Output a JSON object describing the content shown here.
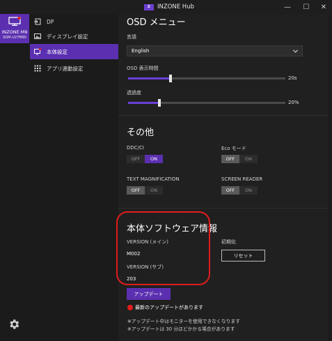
{
  "window": {
    "title": "INZONE Hub",
    "logo_text": "Z",
    "min_glyph": "—",
    "max_glyph": "☐",
    "close_glyph": "✕"
  },
  "monitor": {
    "name": "INZONE M9",
    "model": "SDM-U27M90"
  },
  "sidebar": {
    "items": [
      {
        "label": "DP",
        "icon": "input-source-icon"
      },
      {
        "label": "ディスプレイ設定",
        "icon": "image-icon"
      },
      {
        "label": "本体設定",
        "icon": "monitor-settings-icon",
        "active": true
      },
      {
        "label": "アプリ連動設定",
        "icon": "grid-icon"
      }
    ],
    "settings_icon": "gear-icon"
  },
  "osd": {
    "title": "OSD メニュー",
    "language_label": "言語",
    "language_value": "English",
    "display_time_label": "OSD 表示時間",
    "display_time_value": "20s",
    "display_time_fraction": 0.27,
    "opacity_label": "透過度",
    "opacity_value": "20%",
    "opacity_fraction": 0.2
  },
  "other": {
    "title": "その他",
    "ddcci": {
      "label": "DDC/CI",
      "off": "OFF",
      "on": "ON",
      "state": "on"
    },
    "eco": {
      "label": "Eco モード",
      "off": "OFF",
      "on": "ON",
      "state": "off"
    },
    "text_mag": {
      "label": "TEXT MAGNIFICATION",
      "off": "OFF",
      "on": "ON",
      "state": "off"
    },
    "screen_reader": {
      "label": "SCREEN READER",
      "off": "OFF",
      "on": "ON",
      "state": "off"
    }
  },
  "software": {
    "title": "本体ソフトウェア情報",
    "version_main_label": "VERSION (メイン)",
    "version_main": "M002",
    "version_sub_label": "VERSION (サブ)",
    "version_sub": "203",
    "init_label": "初期化",
    "reset_label": "リセット",
    "update_label": "アップデート",
    "update_alert": "最新のアップデートがあります",
    "note1": "※アップデート中はモニターを使用できなくなります",
    "note2": "※アップデートは 30 分ほどかかる場合があります"
  },
  "colors": {
    "accent": "#5b2fb0",
    "highlight": "#e21c1c"
  }
}
